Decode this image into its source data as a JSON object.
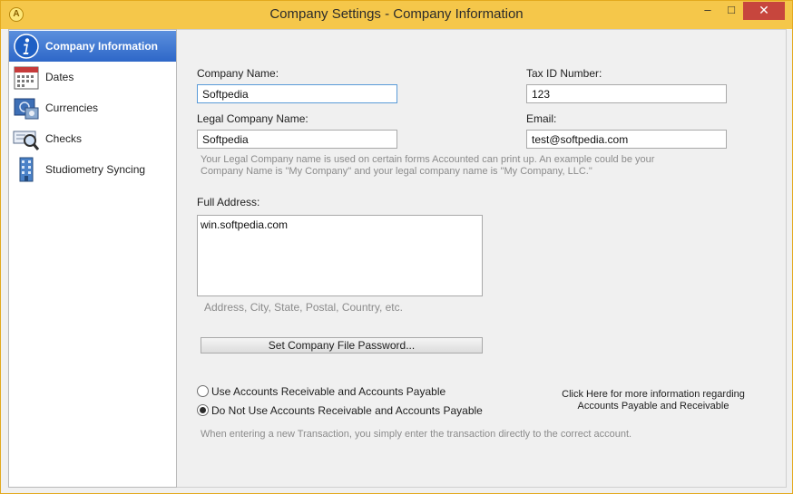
{
  "window": {
    "title": "Company Settings - Company Information",
    "app_icon_glyph": "A",
    "minimize_glyph": "–",
    "maximize_glyph": "□",
    "close_glyph": "✕"
  },
  "sidebar": {
    "items": [
      {
        "label": "Company Information",
        "icon": "info-icon",
        "active": true
      },
      {
        "label": "Dates",
        "icon": "calendar-icon",
        "active": false
      },
      {
        "label": "Currencies",
        "icon": "currency-icon",
        "active": false
      },
      {
        "label": "Checks",
        "icon": "check-magnifier-icon",
        "active": false
      },
      {
        "label": "Studiometry Syncing",
        "icon": "sync-building-icon",
        "active": false
      }
    ]
  },
  "form": {
    "company_name_label": "Company Name:",
    "company_name_value": "Softpedia",
    "tax_id_label": "Tax ID Number:",
    "tax_id_value": "123",
    "legal_name_label": "Legal Company Name:",
    "legal_name_value": "Softpedia",
    "email_label": "Email:",
    "email_value": "test@softpedia.com",
    "legal_name_hint_line1": "Your Legal Company name is used on certain forms Accounted can print up. An example could be your",
    "legal_name_hint_line2": "Company Name is \"My Company\" and your legal company name is \"My Company, LLC.\"",
    "full_address_label": "Full Address:",
    "full_address_value": "win.softpedia.com",
    "address_hint": "Address, City, State, Postal, Country, etc.",
    "password_button": "Set Company File Password...",
    "radio_use_ar_ap": "Use Accounts Receivable and Accounts Payable",
    "radio_no_ar_ap": "Do Not Use Accounts Receivable and Accounts Payable",
    "selected_radio": "no_ar_ap",
    "info_link_line1": "Click Here for more information regarding",
    "info_link_line2": "Accounts Payable and Receivable",
    "transaction_hint": "When entering a new Transaction, you simply enter the transaction directly to the correct account."
  },
  "colors": {
    "titlebar": "#f5c74a",
    "active_nav": "#2e67c8",
    "close_button": "#c7463d"
  }
}
